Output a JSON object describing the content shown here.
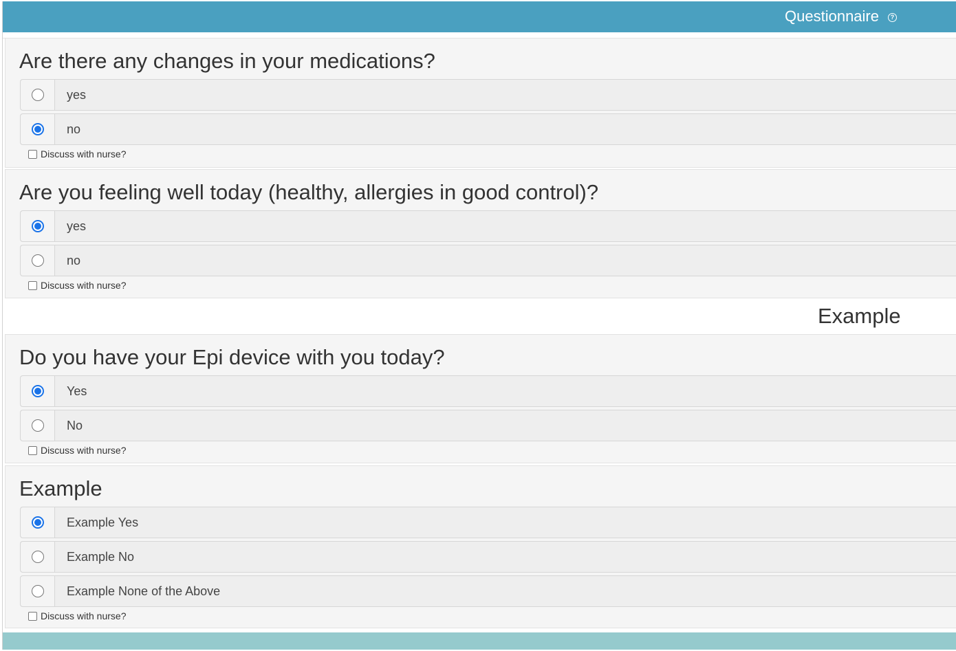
{
  "header": {
    "title": "Questionnaire",
    "help_icon": "?"
  },
  "colors": {
    "header_bg": "#4aa0c0",
    "footer_bg": "#95cacd",
    "radio_checked": "#1a73e8"
  },
  "section_heading": "Example",
  "questions": [
    {
      "title": "Are there any changes in your medications?",
      "options": [
        {
          "label": "yes",
          "checked": false
        },
        {
          "label": "no",
          "checked": true
        }
      ],
      "discuss_label": "Discuss with nurse?",
      "discuss_checked": false
    },
    {
      "title": "Are you feeling well today (healthy, allergies in good control)?",
      "options": [
        {
          "label": "yes",
          "checked": true
        },
        {
          "label": "no",
          "checked": false
        }
      ],
      "discuss_label": "Discuss with nurse?",
      "discuss_checked": false
    },
    {
      "title": "Do you have your Epi device with you today?",
      "options": [
        {
          "label": "Yes",
          "checked": true
        },
        {
          "label": "No",
          "checked": false
        }
      ],
      "discuss_label": "Discuss with nurse?",
      "discuss_checked": false
    },
    {
      "title": "Example",
      "options": [
        {
          "label": "Example Yes",
          "checked": true
        },
        {
          "label": "Example No",
          "checked": false
        },
        {
          "label": "Example None of the Above",
          "checked": false
        }
      ],
      "discuss_label": "Discuss with nurse?",
      "discuss_checked": false
    }
  ]
}
